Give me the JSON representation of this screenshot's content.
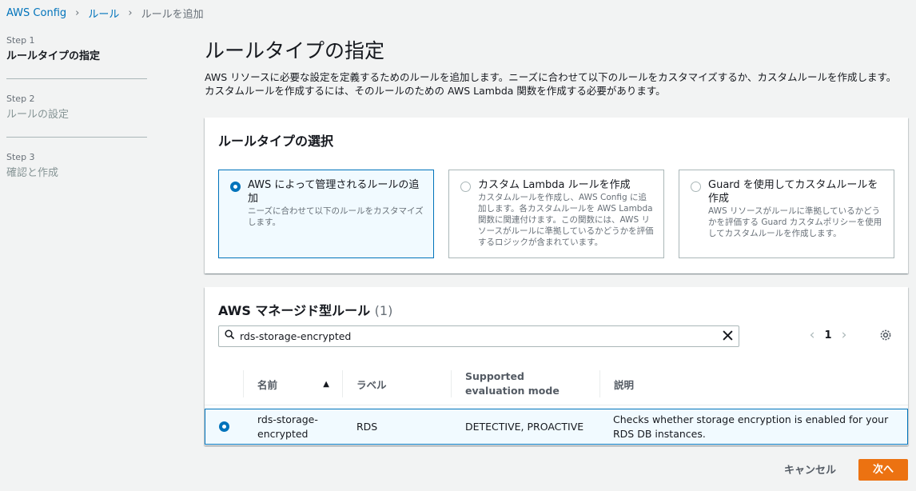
{
  "breadcrumb": [
    "AWS Config",
    "ルール",
    "ルールを追加"
  ],
  "steps": [
    {
      "num": "Step 1",
      "title": "ルールタイプの指定"
    },
    {
      "num": "Step 2",
      "title": "ルールの設定"
    },
    {
      "num": "Step 3",
      "title": "確認と作成"
    }
  ],
  "page": {
    "title": "ルールタイプの指定",
    "description_line1": "AWS リソースに必要な設定を定義するためのルールを追加します。ニーズに合わせて以下のルールをカスタマイズするか、カスタムルールを作成します。",
    "description_line2": "カスタムルールを作成するには、そのルールのための AWS Lambda 関数を作成する必要があります。"
  },
  "rule_type": {
    "heading": "ルールタイプの選択",
    "options": [
      {
        "title": "AWS によって管理されるルールの追加",
        "desc": "ニーズに合わせて以下のルールをカスタマイズします。"
      },
      {
        "title": "カスタム Lambda ルールを作成",
        "desc": "カスタムルールを作成し、AWS Config に追加します。各カスタムルールを AWS Lambda 関数に関連付けます。この関数には、AWS リソースがルールに準拠しているかどうかを評価するロジックが含まれています。"
      },
      {
        "title": "Guard を使用してカスタムルールを作成",
        "desc": "AWS リソースがルールに準拠しているかどうかを評価する Guard カスタムポリシーを使用してカスタムルールを作成します。"
      }
    ]
  },
  "managed_rules": {
    "heading": "AWS マネージド型ルール",
    "count": "(1)",
    "search_value": "rds-storage-encrypted",
    "page": "1",
    "columns": [
      "名前",
      "ラベル",
      "Supported evaluation mode",
      "説明"
    ],
    "rows": [
      {
        "name": "rds-storage-encrypted",
        "label": "RDS",
        "mode": "DETECTIVE, PROACTIVE",
        "desc": "Checks whether storage encryption is enabled for your RDS DB instances."
      }
    ]
  },
  "actions": {
    "cancel": "キャンセル",
    "next": "次へ"
  },
  "colors": {
    "accent": "#0073bb",
    "primary_button": "#ec7211"
  }
}
